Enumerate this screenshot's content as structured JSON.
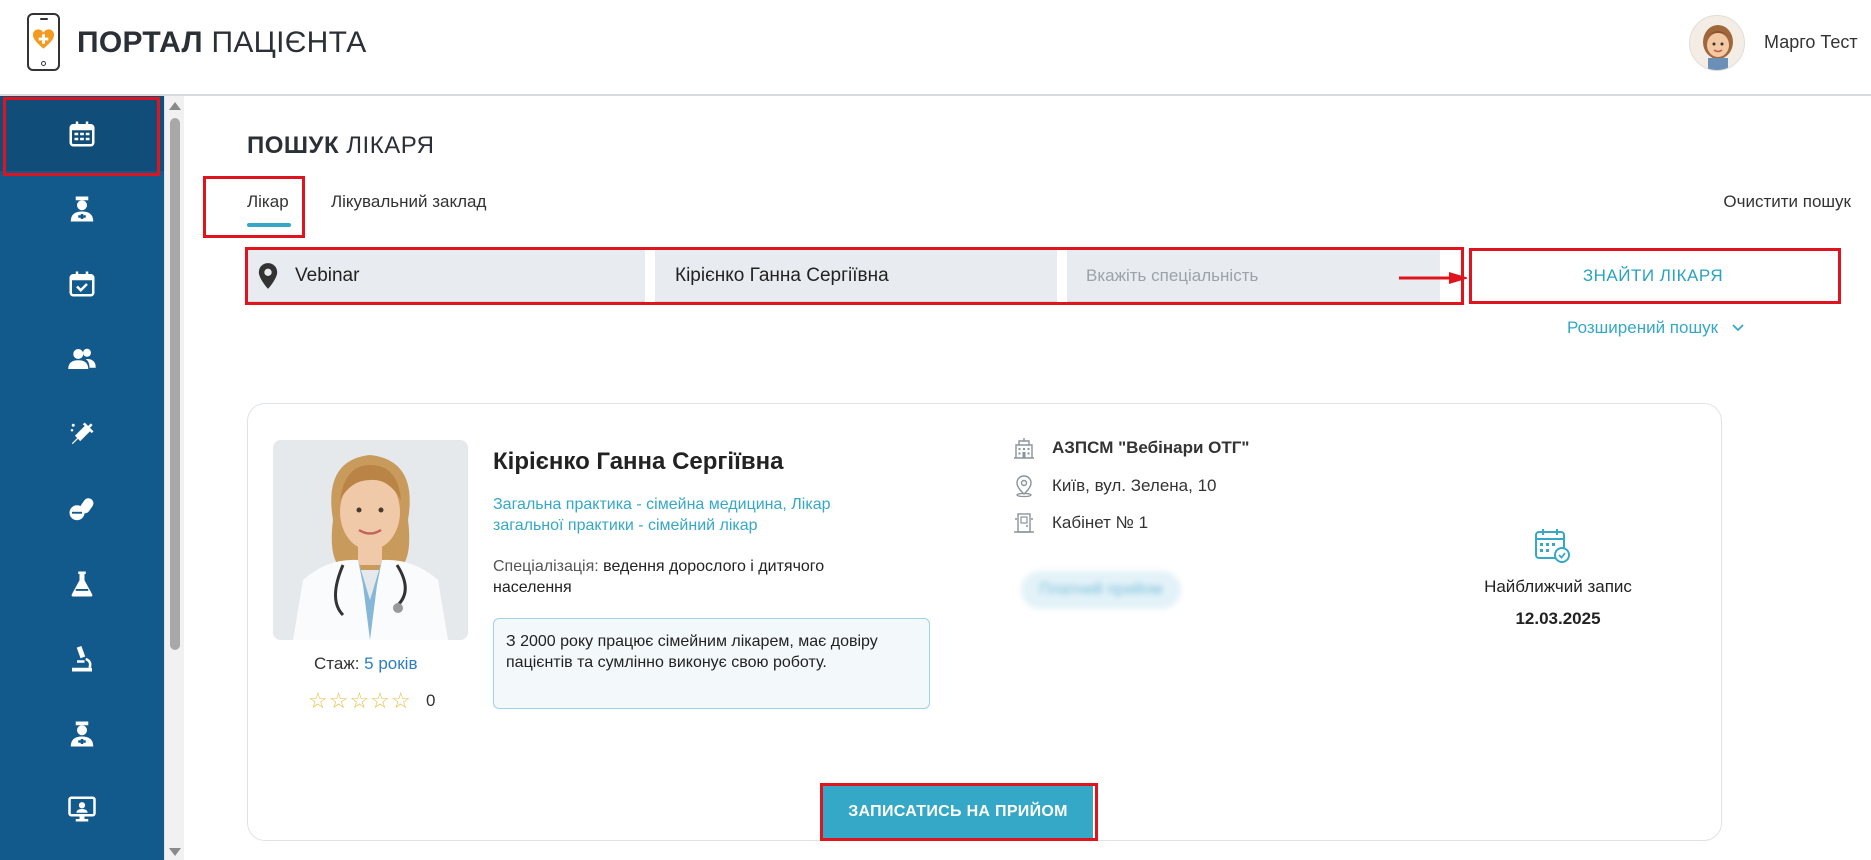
{
  "header": {
    "logo_bold": "ПОРТАЛ",
    "logo_light": "ПАЦІЄНТА",
    "user_name": "Марго Тест"
  },
  "sidebar": {
    "items": [
      {
        "icon": "calendar-icon",
        "active": true
      },
      {
        "icon": "doctor-icon"
      },
      {
        "icon": "calendar-check-icon"
      },
      {
        "icon": "users-icon"
      },
      {
        "icon": "syringe-icon"
      },
      {
        "icon": "pills-icon"
      },
      {
        "icon": "flask-icon"
      },
      {
        "icon": "microscope-icon"
      },
      {
        "icon": "doctor-alt-icon"
      },
      {
        "icon": "telemedicine-icon"
      }
    ]
  },
  "page": {
    "title_bold": "ПОШУК",
    "title_light": "ЛІКАРЯ",
    "tabs": [
      {
        "label": "Лікар",
        "active": true
      },
      {
        "label": "Лікувальний заклад"
      }
    ],
    "clear_search": "Очистити пошук"
  },
  "search": {
    "location_value": "Vebinar",
    "doctor_value": "Кірієнко Ганна Сергіївна",
    "specialty_placeholder": "Вкажіть спеціальність",
    "find_button": "ЗНАЙТИ ЛІКАРЯ",
    "advanced": "Розширений пошук"
  },
  "doctor": {
    "name": "Кірієнко Ганна Сергіївна",
    "specialties": "Загальна практика - сімейна медицина, Лікар загальної практики - сімейний лікар",
    "specialization_label": "Спеціалізація:",
    "specialization_value": "ведення дорослого і дитячого населення",
    "about": "З 2000 року працює сімейним лікарем, має довіру пацієнтів та сумлінно виконує свою роботу.",
    "experience_label": "Стаж:",
    "experience_value": "5 років",
    "stars": "☆☆☆☆☆",
    "rating": "0",
    "clinic": "АЗПСМ \"Вебінари ОТГ\"",
    "address": "Київ, вул. Зелена, 10",
    "room": "Кабінет № 1",
    "paid_badge": "Платний прийом",
    "nearest_label": "Найближчий запис",
    "nearest_date": "12.03.2025",
    "book_button": "ЗАПИСАТИСЬ НА ПРИЙОМ"
  },
  "colors": {
    "sidebar": "#135a8c",
    "accent": "#35a7c7",
    "highlight": "#e0141e"
  }
}
